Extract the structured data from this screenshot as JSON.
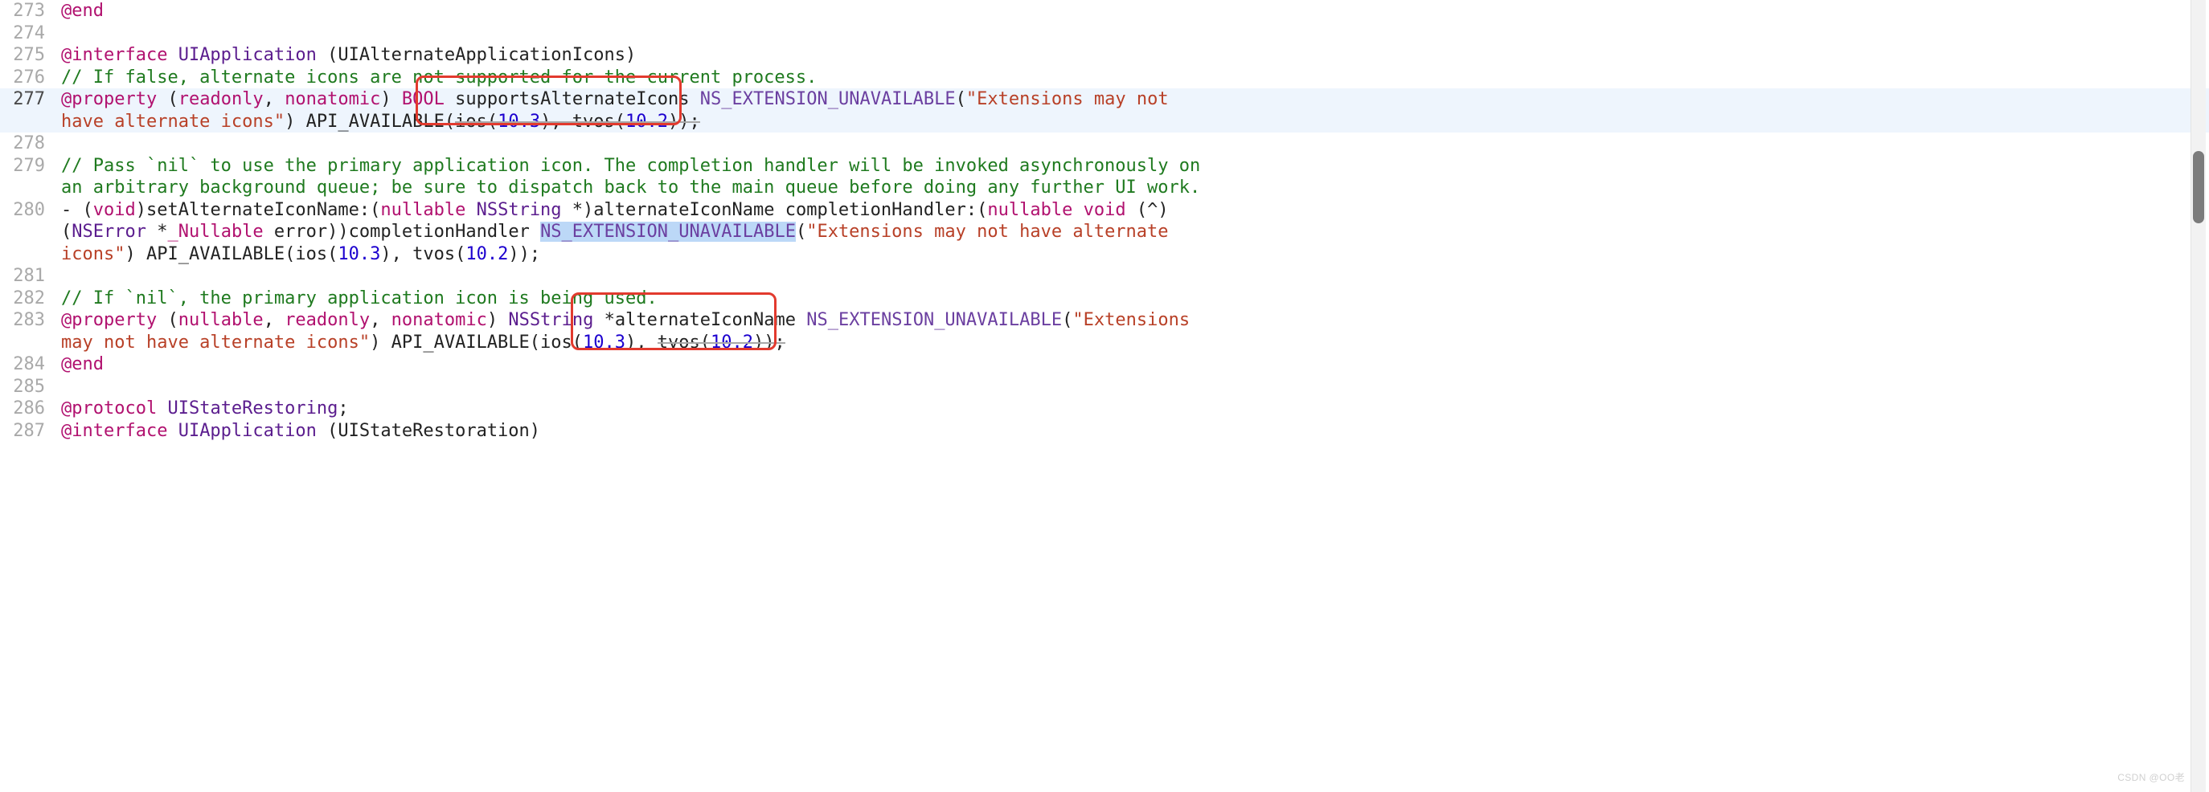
{
  "lines": {
    "l273_num": "273",
    "l273_a": "@end",
    "l274_num": "274",
    "l275_num": "275",
    "l275_a": "@interface",
    "l275_b": " UIApplication",
    "l275_c": " (UIAlternateApplicationIcons)",
    "l276_num": "276",
    "l276_a": "// If false, alternate icons are not supported for the current process.",
    "l277_num": "277",
    "l277_a": "@property",
    "l277_b": " (",
    "l277_c": "readonly",
    "l277_d": ", ",
    "l277_e": "nonatomic",
    "l277_f": ") ",
    "l277_g": "BOOL",
    "l277_h": " supportsAlternateIcons ",
    "l277_i": "NS_EXTENSION_UNAVAILABLE",
    "l277_j": "(",
    "l277_k": "\"Extensions may not have alternate icons\"",
    "l277_l": ") ",
    "l277_m": "API_AVAILABLE(",
    "l277_n": "ios(",
    "l277_o": "10.3",
    "l277_p": "), tvos(",
    "l277_q": "10.2",
    "l277_r": "));",
    "l278_num": "278",
    "l279_num": "279",
    "l279_a": "// Pass `nil` to use the primary application icon. The completion handler will be invoked asynchronously on an arbitrary background queue; be sure to dispatch back to the main queue before doing any further UI work.",
    "l280_num": "280",
    "l280_a": "- (",
    "l280_b": "void",
    "l280_c": ")setAlternateIconName:(",
    "l280_d": "nullable",
    "l280_e": " NSString",
    "l280_f": " *)alternateIconName completionHandler:(",
    "l280_g": "nullable",
    "l280_h": " void",
    "l280_i": " (^)(",
    "l280_j": "NSError",
    "l280_k": " *",
    "l280_l": "_Nullable",
    "l280_m": " error))completionHandler ",
    "l280_n": "NS_EXTENSION_UNAVAILABLE",
    "l280_o": "(",
    "l280_p": "\"Extensions may not have alternate icons\"",
    "l280_q": ") API_AVAILABLE(ios(",
    "l280_r": "10.3",
    "l280_s": "), tvos(",
    "l280_t": "10.2",
    "l280_u": "));",
    "l281_num": "281",
    "l282_num": "282",
    "l282_a": "// If `nil`, the primary application icon is being used.",
    "l283_num": "283",
    "l283_a": "@property",
    "l283_b": " (",
    "l283_c": "nullable",
    "l283_d": ", ",
    "l283_e": "readonly",
    "l283_f": ", ",
    "l283_g": "nonatomic",
    "l283_h": ") ",
    "l283_i": "NSString",
    "l283_j": " *alternateIconName ",
    "l283_k": "NS_EXTENSION_UNAVAILABLE",
    "l283_l": "(",
    "l283_m": "\"Extensions may not have alternate icons\"",
    "l283_n": ") API_AVAILABLE(ios(",
    "l283_o": "10.3",
    "l283_p": "), ",
    "l283_q": "tvos(",
    "l283_r": "10.2",
    "l283_s": "));",
    "l284_num": "284",
    "l284_a": "@end",
    "l285_num": "285",
    "l286_num": "286",
    "l286_a": "@protocol",
    "l286_b": " UIStateRestoring",
    "l286_c": ";",
    "l287_num": "287",
    "l287_a": "@interface",
    "l287_b": " UIApplication",
    "l287_c": " (UIStateRestoration)"
  },
  "watermark": "CSDN @OO老"
}
